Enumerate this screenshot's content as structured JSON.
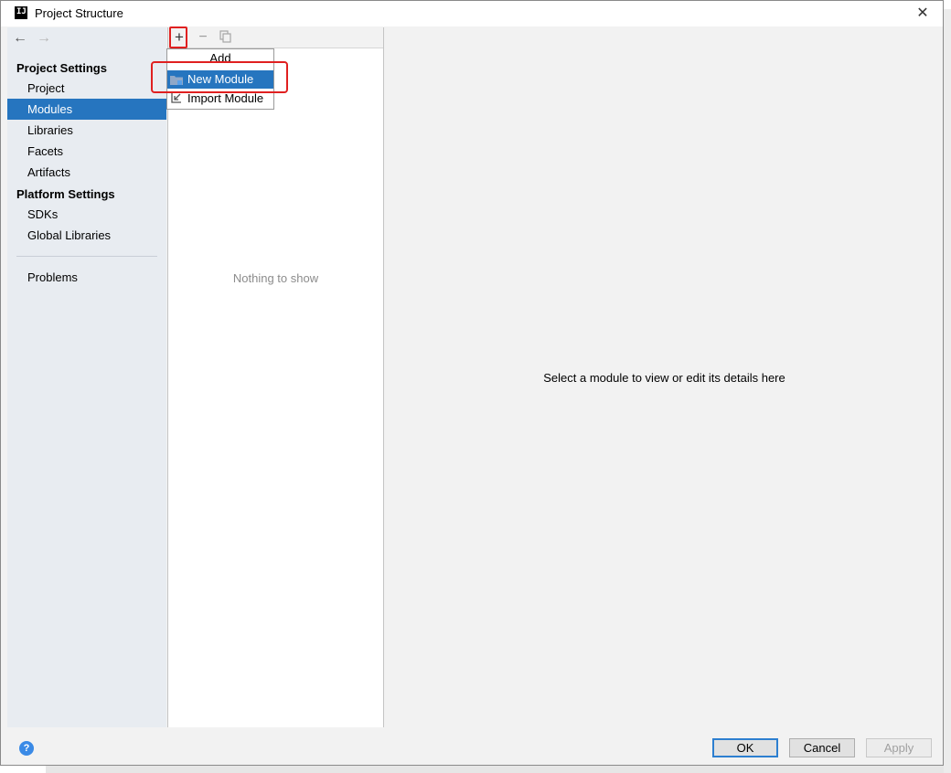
{
  "window": {
    "title": "Project Structure"
  },
  "sidebar": {
    "sections": [
      {
        "label": "Project Settings"
      },
      {
        "label": "Platform Settings"
      }
    ],
    "project_items": [
      "Project",
      "Modules",
      "Libraries",
      "Facets",
      "Artifacts"
    ],
    "platform_items": [
      "SDKs",
      "Global Libraries"
    ],
    "other_items": [
      "Problems"
    ],
    "selected": "Modules"
  },
  "list": {
    "empty_text": "Nothing to show"
  },
  "popup": {
    "header": "Add",
    "items": [
      "New Module",
      "Import Module"
    ],
    "selected": "New Module"
  },
  "detail": {
    "message": "Select a module to view or edit its details here"
  },
  "footer": {
    "help_label": "?",
    "ok_label": "OK",
    "cancel_label": "Cancel",
    "apply_label": "Apply"
  },
  "colors": {
    "selection": "#2675bf",
    "highlight": "#e02020"
  }
}
